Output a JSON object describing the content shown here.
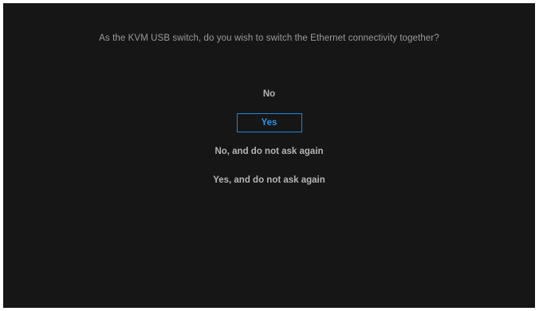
{
  "dialog": {
    "question": "As the KVM USB switch, do you wish to switch the Ethernet connectivity together?",
    "options": [
      {
        "label": "No"
      },
      {
        "label": "Yes",
        "selected": true
      },
      {
        "label": "No, and do not ask again"
      },
      {
        "label": "Yes, and do not ask again"
      }
    ]
  },
  "colors": {
    "background": "#161616",
    "text": "#b4b4b4",
    "accent": "#1f86d9"
  }
}
